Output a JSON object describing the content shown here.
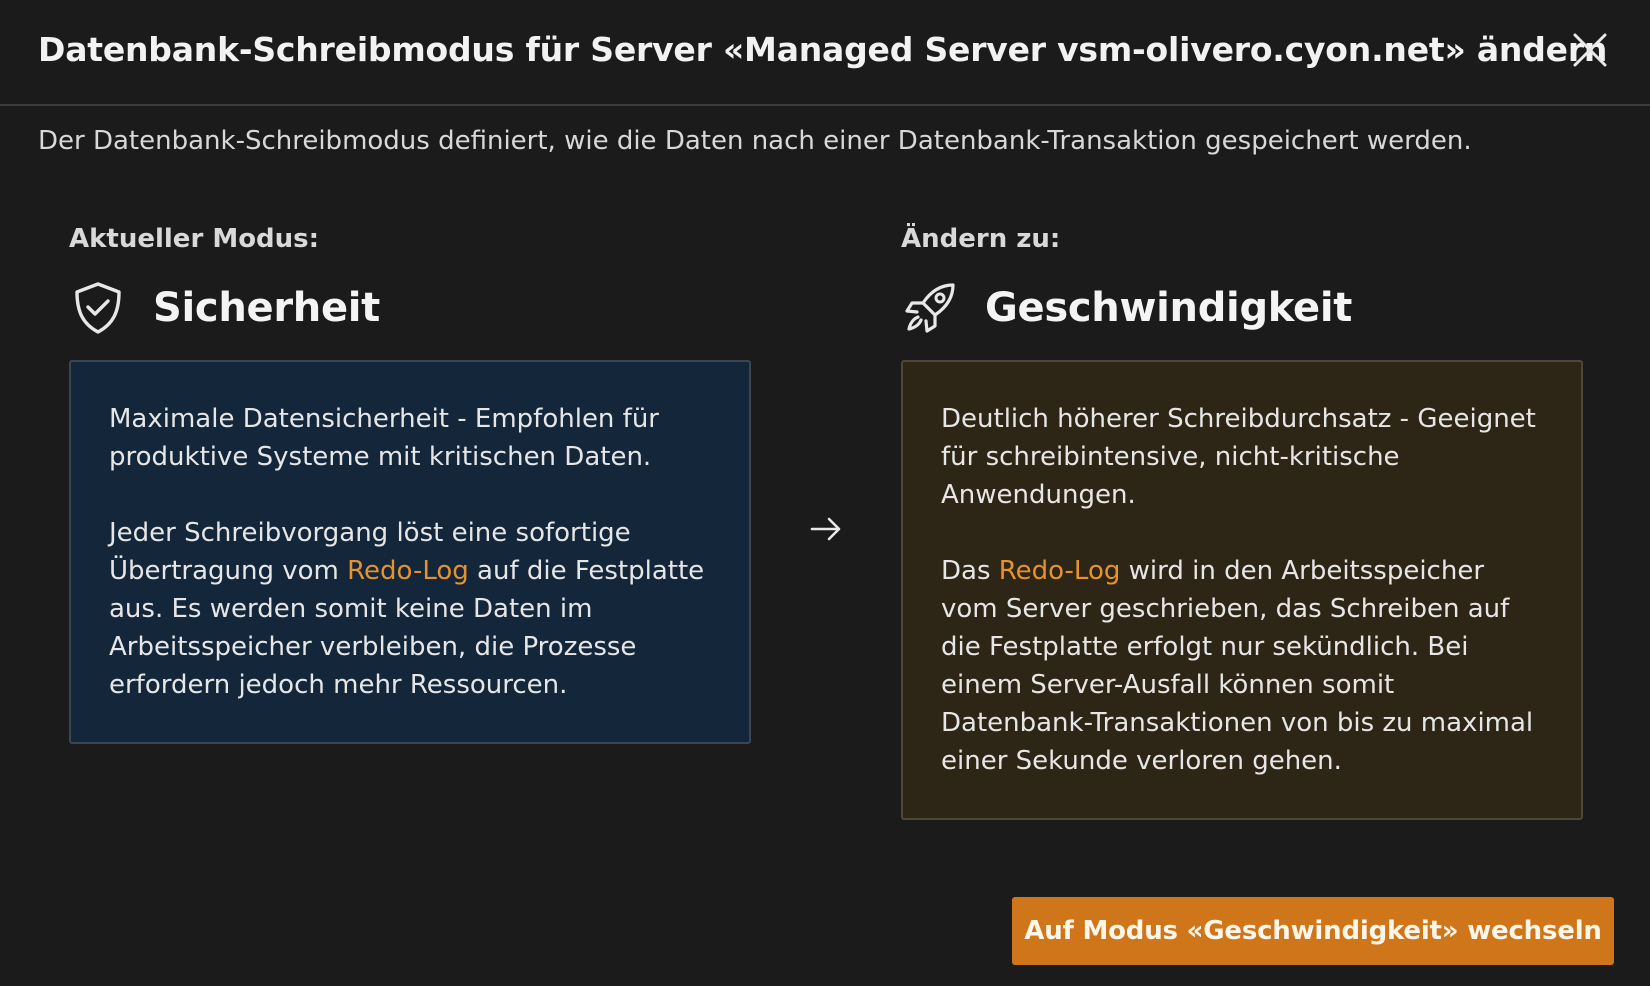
{
  "dialog": {
    "title": "Datenbank-Schreibmodus für Server «Managed Server vsm-olivero.cyon.net» ändern",
    "close_icon": "close-icon",
    "description": "Der Datenbank-Schreibmodus definiert, wie die Daten nach einer Datenbank-Transaktion gespeichert werden."
  },
  "current": {
    "label": "Aktueller Modus:",
    "icon": "shield-check-icon",
    "name": "Sicherheit",
    "para1": "Maximale Datensicherheit - Empfohlen für produktive Systeme mit kritischen Daten.",
    "para2_before": "Jeder Schreibvorgang löst eine sofortige Übertragung vom ",
    "para2_link": "Redo-Log",
    "para2_after": " auf die Festplatte aus. Es werden somit keine Daten im Arbeitsspeicher verbleiben, die Prozesse erfordern jedoch mehr Ressourcen."
  },
  "arrow_icon": "arrow-right-icon",
  "target": {
    "label": "Ändern zu:",
    "icon": "rocket-icon",
    "name": "Geschwindigkeit",
    "para1": "Deutlich höherer Schreibdurchsatz - Geeignet für schreibintensive, nicht-kritische Anwendungen.",
    "para2_before": "Das ",
    "para2_link": "Redo-Log",
    "para2_after": " wird in den Arbeitsspeicher vom Server geschrieben, das Schreiben auf die Festplatte erfolgt nur sekündlich. Bei einem Server-Ausfall können somit Datenbank-Transaktionen von bis zu maximal einer Sekunde verloren gehen."
  },
  "actions": {
    "switch_label": "Auf Modus «Geschwindigkeit» wechseln"
  },
  "colors": {
    "background": "#1b1b1c",
    "safe_card": "#13263a",
    "fast_card": "#2d2616",
    "accent": "#cf761b",
    "link": "#e6922e"
  }
}
